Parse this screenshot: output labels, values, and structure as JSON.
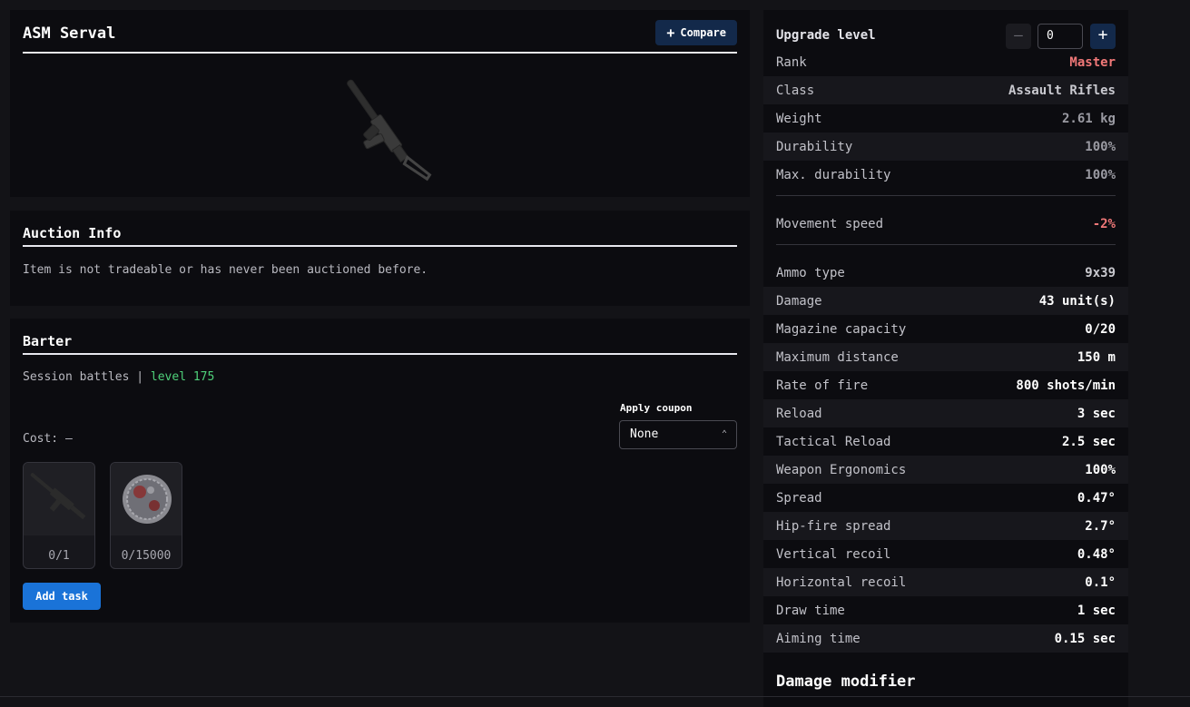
{
  "item": {
    "title": "ASM Serval",
    "compare_label": "Compare",
    "compare_icon": "plus-icon"
  },
  "auction": {
    "title": "Auction Info",
    "message": "Item is not tradeable or has never been auctioned before."
  },
  "barter": {
    "title": "Barter",
    "session_text": "Session battles",
    "separator": "|",
    "level_text": "level 175",
    "coupon_label": "Apply coupon",
    "coupon_value": "None",
    "cost_text": "Cost: –",
    "items": [
      {
        "quantity": "0/1",
        "icon": "rifle-icon"
      },
      {
        "quantity": "0/15000",
        "icon": "coin-icon"
      }
    ],
    "add_task_label": "Add task"
  },
  "stats": {
    "upgrade_label": "Upgrade level",
    "upgrade_value": "0",
    "rows": [
      {
        "label": "Rank",
        "value": "Master",
        "color": "#f07878"
      },
      {
        "label": "Class",
        "value": "Assault Rifles",
        "color": "#c9c9cf"
      },
      {
        "label": "Weight",
        "value": "2.61 kg",
        "color": "#9a9aa2"
      },
      {
        "label": "Durability",
        "value": "100%",
        "color": "#9a9aa2"
      },
      {
        "label": "Max. durability",
        "value": "100%",
        "color": "#9a9aa2"
      },
      {
        "label": "Movement speed",
        "value": "-2%",
        "color": "#f07878"
      },
      {
        "label": "Ammo type",
        "value": "9x39",
        "color": "#c9c9cf"
      },
      {
        "label": "Damage",
        "value": "43 unit(s)",
        "color": "#ffffff"
      },
      {
        "label": "Magazine capacity",
        "value": "0/20",
        "color": "#ffffff"
      },
      {
        "label": "Maximum distance",
        "value": "150 m",
        "color": "#ffffff"
      },
      {
        "label": "Rate of fire",
        "value": "800 shots/min",
        "color": "#ffffff"
      },
      {
        "label": "Reload",
        "value": "3 sec",
        "color": "#ffffff"
      },
      {
        "label": "Tactical Reload",
        "value": "2.5 sec",
        "color": "#ffffff"
      },
      {
        "label": "Weapon Ergonomics",
        "value": "100%",
        "color": "#ffffff"
      },
      {
        "label": "Spread",
        "value": "0.47°",
        "color": "#ffffff"
      },
      {
        "label": "Hip-fire spread",
        "value": "2.7°",
        "color": "#ffffff"
      },
      {
        "label": "Vertical recoil",
        "value": "0.48°",
        "color": "#ffffff"
      },
      {
        "label": "Horizontal recoil",
        "value": "0.1°",
        "color": "#ffffff"
      },
      {
        "label": "Draw time",
        "value": "1 sec",
        "color": "#ffffff"
      },
      {
        "label": "Aiming time",
        "value": "0.15 sec",
        "color": "#ffffff"
      }
    ],
    "damage_modifier_title": "Damage modifier"
  }
}
